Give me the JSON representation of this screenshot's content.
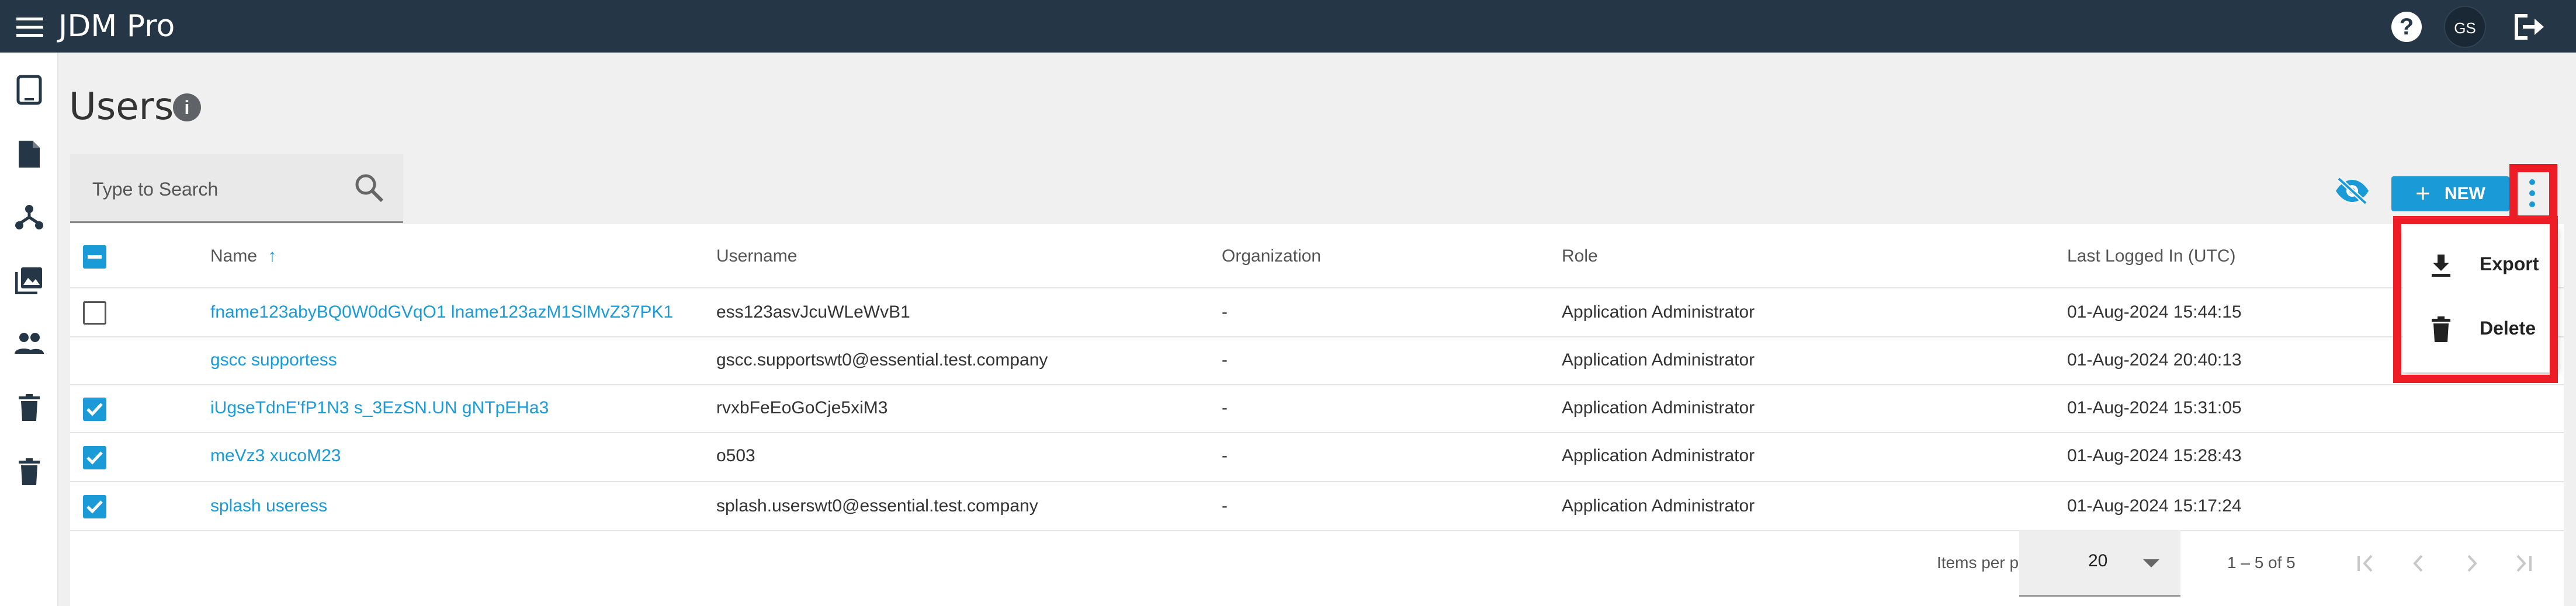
{
  "app": {
    "title": "JDM Pro"
  },
  "header": {
    "help_label": "?",
    "avatar_initials": "GS"
  },
  "sidebar": {
    "items": [
      {
        "icon": "tablet-icon"
      },
      {
        "icon": "document-icon"
      },
      {
        "icon": "hierarchy-icon"
      },
      {
        "icon": "images-icon"
      },
      {
        "icon": "users-icon",
        "active": true
      },
      {
        "icon": "trash-icon"
      },
      {
        "icon": "trash-icon"
      }
    ]
  },
  "page": {
    "title": "Users",
    "info_label": "i"
  },
  "search": {
    "placeholder": "Type to Search",
    "value": ""
  },
  "toolbar": {
    "new_plus": "+",
    "new_label": "NEW"
  },
  "table": {
    "columns": {
      "name": "Name",
      "sort_arrow": "↑",
      "username": "Username",
      "organization": "Organization",
      "role": "Role",
      "last_logged_in": "Last Logged In (UTC)"
    },
    "rows": [
      {
        "selection": "unchecked",
        "name": "fname123abyBQ0W0dGVqO1 lname123azM1SlMvZ37PK1",
        "username": "ess123asvJcuWLeWvB1",
        "organization": "-",
        "role": "Application Administrator",
        "last_logged_in": "01-Aug-2024 15:44:15"
      },
      {
        "selection": "none",
        "name": "gscc supportess",
        "username": "gscc.supportswt0@essential.test.company",
        "organization": "-",
        "role": "Application Administrator",
        "last_logged_in": "01-Aug-2024 20:40:13"
      },
      {
        "selection": "checked",
        "name": "iUgseTdnE'fP1N3 s_3EzSN.UN gNTpEHa3",
        "username": "rvxbFeEoGoCje5xiM3",
        "organization": "-",
        "role": "Application Administrator",
        "last_logged_in": "01-Aug-2024 15:31:05"
      },
      {
        "selection": "checked",
        "name": "meVz3 xucoM23",
        "username": "o503",
        "organization": "-",
        "role": "Application Administrator",
        "last_logged_in": "01-Aug-2024 15:28:43"
      },
      {
        "selection": "checked",
        "name": "splash useress",
        "username": "splash.userswt0@essential.test.company",
        "organization": "-",
        "role": "Application Administrator",
        "last_logged_in": "01-Aug-2024 15:17:24"
      }
    ]
  },
  "paginator": {
    "items_per_page_label": "Items per page:",
    "page_size": "20",
    "range_label": "1 – 5 of 5"
  },
  "more_menu": {
    "items": [
      {
        "label": "Export",
        "icon": "download-icon"
      },
      {
        "label": "Delete",
        "icon": "trash-icon"
      }
    ]
  },
  "colors": {
    "topbar": "#253746",
    "accent": "#1a9ad6",
    "highlight": "#ee1c25"
  }
}
